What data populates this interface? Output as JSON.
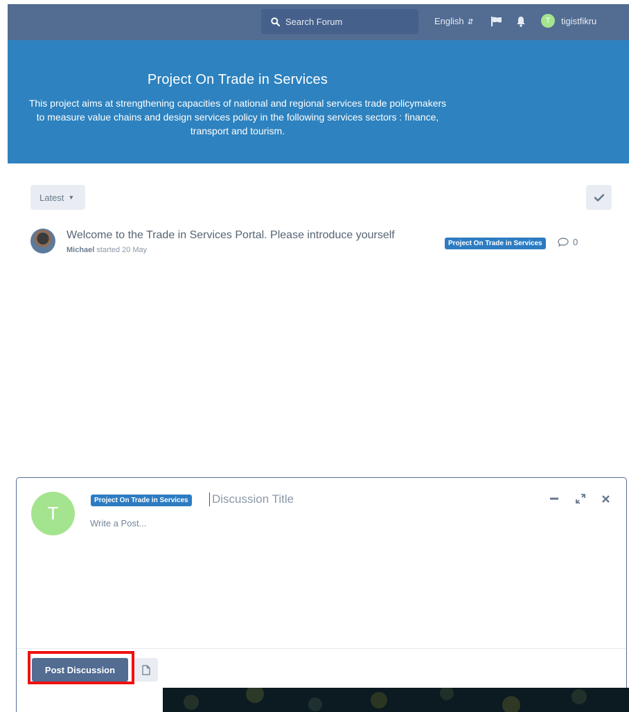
{
  "header": {
    "search_placeholder": "Search Forum",
    "language": "English",
    "user_initial": "T",
    "username": "tigistfikru"
  },
  "hero": {
    "title": "Project On Trade in Services",
    "description": "This project aims at strengthening capacities of national and regional services trade policymakers to measure value chains and design services policy in the following services sectors : finance, transport and tourism."
  },
  "toolbar": {
    "sort_label": "Latest"
  },
  "discussions": [
    {
      "title": "Welcome to the Trade in Services Portal. Please introduce yourself",
      "author": "Michael",
      "meta": "started 20 May",
      "tag": "Project On Trade in Services",
      "replies": "0"
    }
  ],
  "composer": {
    "avatar_initial": "T",
    "tag": "Project On Trade in Services",
    "title_placeholder": "Discussion Title",
    "body_placeholder": "Write a Post...",
    "submit_label": "Post Discussion"
  },
  "colors": {
    "header_bg": "#526c92",
    "hero_bg": "#2d82bf",
    "tag_bg": "#2d7cc2",
    "avatar_bg": "#a5e48f",
    "highlight": "#ee1111"
  },
  "icons": {
    "search": "search-icon",
    "flag": "flag-icon",
    "bell": "bell-icon",
    "check": "check-icon",
    "comment": "comment-icon",
    "minimize": "minimize-icon",
    "expand": "expand-icon",
    "close": "close-icon",
    "file": "file-icon"
  }
}
